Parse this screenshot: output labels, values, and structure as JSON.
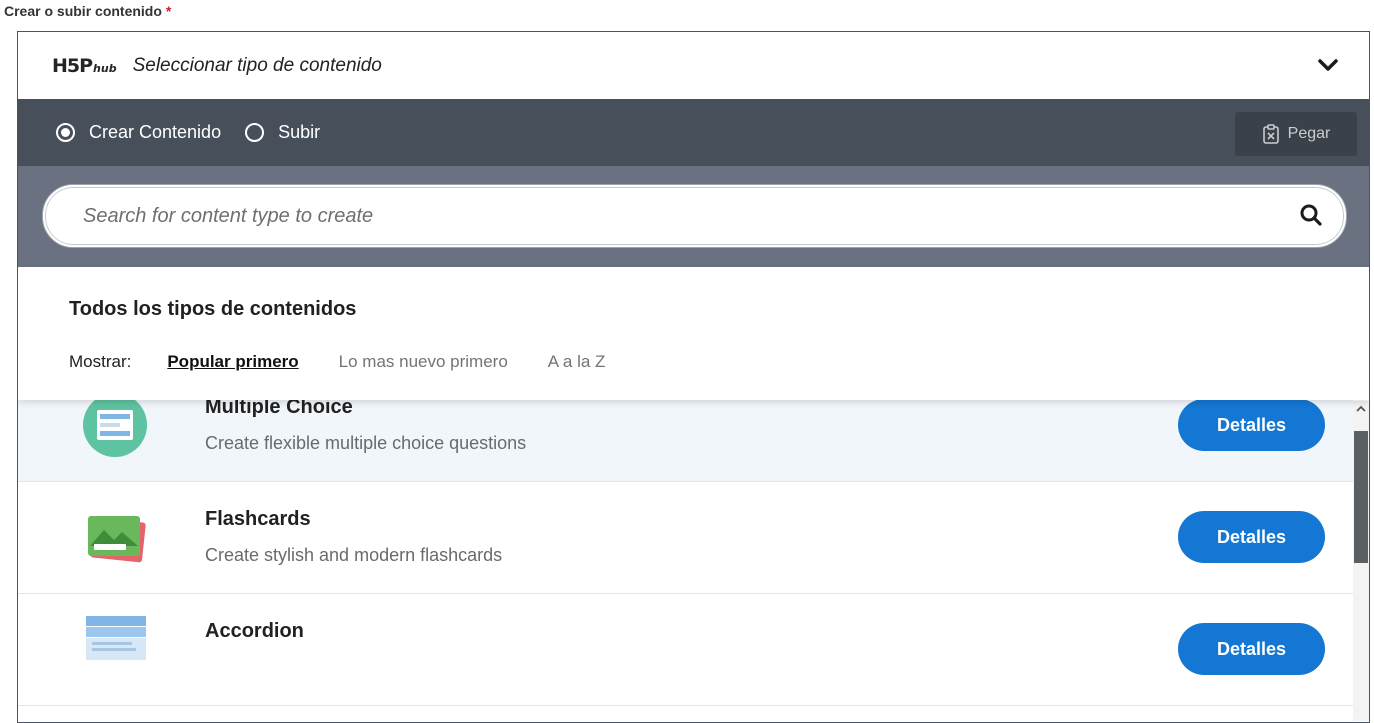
{
  "field": {
    "label": "Crear o subir contenido",
    "required_mark": "*"
  },
  "hub": {
    "logo": "H5P",
    "logo_sub": "hub",
    "title": "Seleccionar tipo de contenido"
  },
  "tabs": {
    "create_label": "Crear Contenido",
    "upload_label": "Subir",
    "selected": "create",
    "paste_label": "Pegar"
  },
  "search": {
    "placeholder": "Search for content type to create",
    "value": ""
  },
  "types": {
    "heading": "Todos los tipos de contenidos",
    "show_label": "Mostrar:",
    "sort_options": [
      "Popular primero",
      "Lo mas nuevo primero",
      "A a la Z"
    ],
    "active_sort": "Popular primero"
  },
  "items": [
    {
      "title": "Multiple Choice",
      "description": "Create flexible multiple choice questions",
      "button": "Detalles",
      "icon": "multiple-choice-icon"
    },
    {
      "title": "Flashcards",
      "description": "Create stylish and modern flashcards",
      "button": "Detalles",
      "icon": "flashcards-icon"
    },
    {
      "title": "Accordion",
      "description": "",
      "button": "Detalles",
      "icon": "accordion-icon"
    }
  ],
  "colors": {
    "tab_bar": "#474f5a",
    "search_band": "#6a7281",
    "details_button": "#1477d3",
    "highlight_row": "#f1f6fb"
  }
}
